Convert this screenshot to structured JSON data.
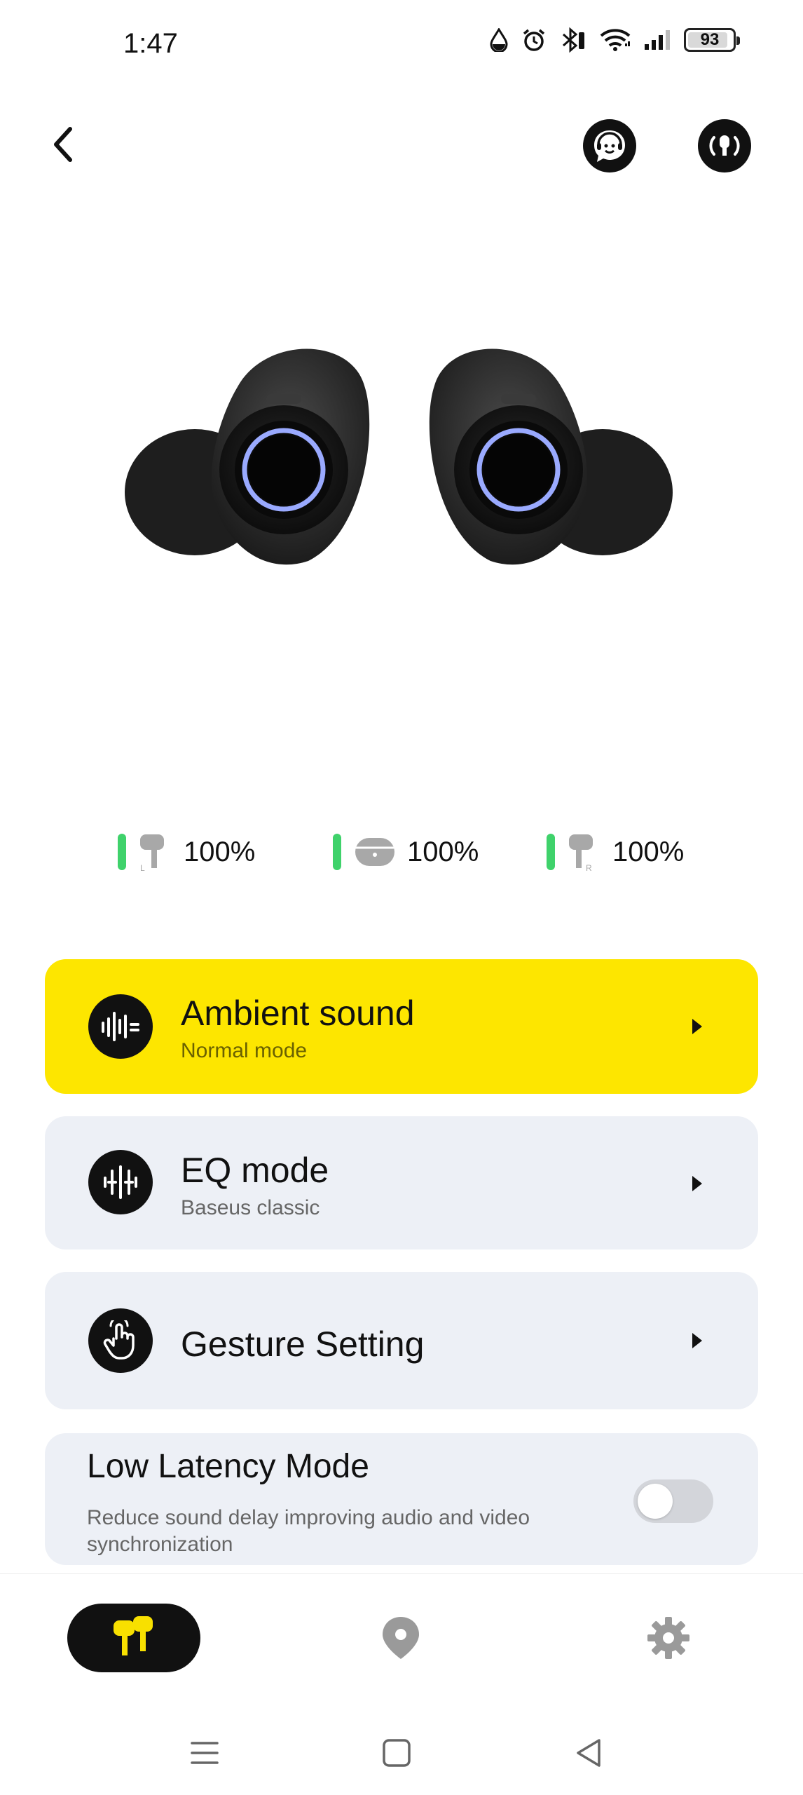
{
  "status_bar": {
    "time": "1:47",
    "battery_level": "93",
    "icons": [
      "drop-icon",
      "alarm-icon",
      "bluetooth-icon",
      "wifi-icon",
      "signal-icon",
      "battery-icon"
    ]
  },
  "header": {
    "icons": [
      "back-icon",
      "customer-service-icon",
      "find-earbuds-icon"
    ]
  },
  "battery": {
    "left": {
      "icon": "left-earbud-icon",
      "label": "L",
      "value": "100%"
    },
    "case": {
      "icon": "charging-case-icon",
      "value": "100%"
    },
    "right": {
      "icon": "right-earbud-icon",
      "label": "R",
      "value": "100%"
    },
    "bar_color": "#3fd26b"
  },
  "cards": {
    "ambient": {
      "title": "Ambient sound",
      "subtitle": "Normal mode",
      "icon": "ambient-sound-icon"
    },
    "eq": {
      "title": "EQ mode",
      "subtitle": "Baseus classic",
      "icon": "eq-icon"
    },
    "gesture": {
      "title": "Gesture Setting",
      "icon": "gesture-hand-icon"
    },
    "latency": {
      "title": "Low Latency Mode",
      "subtitle": "Reduce sound delay improving audio and video synchronization",
      "enabled": false
    }
  },
  "bottom_nav": {
    "items": [
      "earbuds-icon",
      "location-icon",
      "settings-icon"
    ],
    "active": "earbuds-icon"
  },
  "colors": {
    "accent_yellow": "#fde600",
    "card_gray": "#edf0f6",
    "dark": "#111111"
  }
}
